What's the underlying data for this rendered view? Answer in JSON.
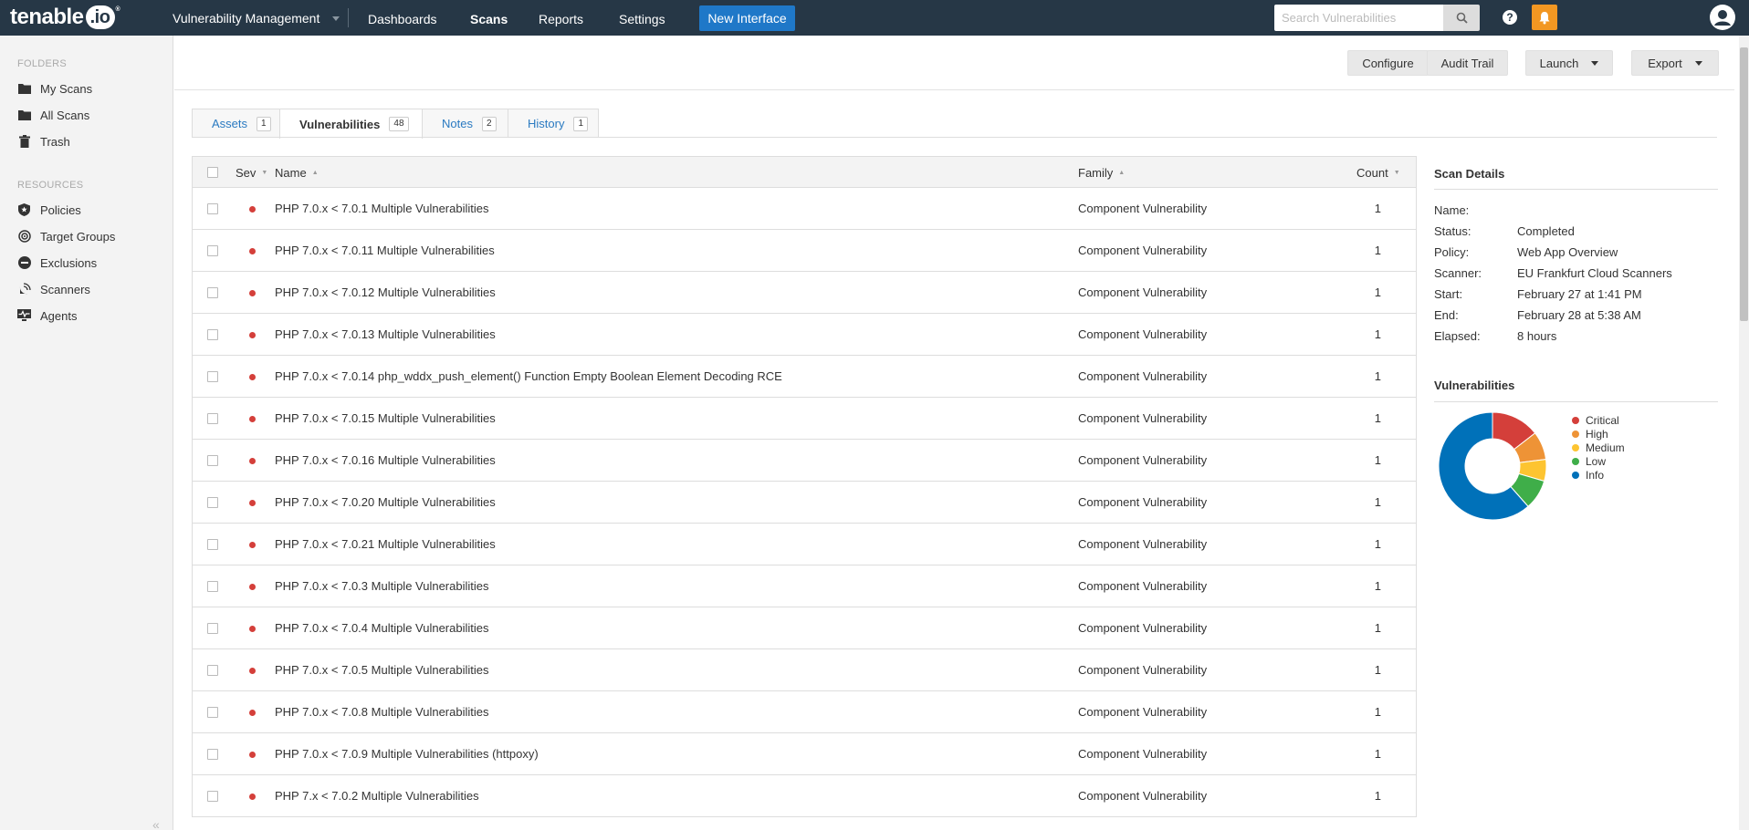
{
  "topbar": {
    "logo_text": "tenable",
    "logo_io": ".io",
    "logo_tm": "®",
    "app_menu": "Vulnerability Management",
    "nav": [
      "Dashboards",
      "Scans",
      "Reports",
      "Settings"
    ],
    "active_nav": "Scans",
    "new_interface": "New Interface",
    "search_placeholder": "Search Vulnerabilities"
  },
  "sidebar": {
    "folders_label": "FOLDERS",
    "folders": [
      "My Scans",
      "All Scans",
      "Trash"
    ],
    "resources_label": "RESOURCES",
    "resources": [
      "Policies",
      "Target Groups",
      "Exclusions",
      "Scanners",
      "Agents"
    ],
    "collapse": "«"
  },
  "toolbar": {
    "configure": "Configure",
    "audit_trail": "Audit Trail",
    "launch": "Launch",
    "export": "Export"
  },
  "tabs": [
    {
      "label": "Assets",
      "count": "1"
    },
    {
      "label": "Vulnerabilities",
      "count": "48"
    },
    {
      "label": "Notes",
      "count": "2"
    },
    {
      "label": "History",
      "count": "1"
    }
  ],
  "table": {
    "headers": {
      "sev": "Sev",
      "name": "Name",
      "family": "Family",
      "count": "Count"
    },
    "rows": [
      {
        "name": "PHP 7.0.x < 7.0.1 Multiple Vulnerabilities",
        "family": "Component Vulnerability",
        "count": "1"
      },
      {
        "name": "PHP 7.0.x < 7.0.11 Multiple Vulnerabilities",
        "family": "Component Vulnerability",
        "count": "1"
      },
      {
        "name": "PHP 7.0.x < 7.0.12 Multiple Vulnerabilities",
        "family": "Component Vulnerability",
        "count": "1"
      },
      {
        "name": "PHP 7.0.x < 7.0.13 Multiple Vulnerabilities",
        "family": "Component Vulnerability",
        "count": "1"
      },
      {
        "name": "PHP 7.0.x < 7.0.14 php_wddx_push_element() Function Empty Boolean Element Decoding RCE",
        "family": "Component Vulnerability",
        "count": "1"
      },
      {
        "name": "PHP 7.0.x < 7.0.15 Multiple Vulnerabilities",
        "family": "Component Vulnerability",
        "count": "1"
      },
      {
        "name": "PHP 7.0.x < 7.0.16 Multiple Vulnerabilities",
        "family": "Component Vulnerability",
        "count": "1"
      },
      {
        "name": "PHP 7.0.x < 7.0.20 Multiple Vulnerabilities",
        "family": "Component Vulnerability",
        "count": "1"
      },
      {
        "name": "PHP 7.0.x < 7.0.21 Multiple Vulnerabilities",
        "family": "Component Vulnerability",
        "count": "1"
      },
      {
        "name": "PHP 7.0.x < 7.0.3 Multiple Vulnerabilities",
        "family": "Component Vulnerability",
        "count": "1"
      },
      {
        "name": "PHP 7.0.x < 7.0.4 Multiple Vulnerabilities",
        "family": "Component Vulnerability",
        "count": "1"
      },
      {
        "name": "PHP 7.0.x < 7.0.5 Multiple Vulnerabilities",
        "family": "Component Vulnerability",
        "count": "1"
      },
      {
        "name": "PHP 7.0.x < 7.0.8 Multiple Vulnerabilities",
        "family": "Component Vulnerability",
        "count": "1"
      },
      {
        "name": "PHP 7.0.x < 7.0.9 Multiple Vulnerabilities (httpoxy)",
        "family": "Component Vulnerability",
        "count": "1"
      },
      {
        "name": "PHP 7.x < 7.0.2 Multiple Vulnerabilities",
        "family": "Component Vulnerability",
        "count": "1"
      }
    ],
    "severity_color": "#d43f3a"
  },
  "scan_details": {
    "title": "Scan Details",
    "items": [
      {
        "key": "Name:",
        "value": ""
      },
      {
        "key": "Status:",
        "value": "Completed"
      },
      {
        "key": "Policy:",
        "value": "Web App Overview"
      },
      {
        "key": "Scanner:",
        "value": "EU Frankfurt Cloud Scanners"
      },
      {
        "key": "Start:",
        "value": "February 27 at  1:41 PM"
      },
      {
        "key": "End:",
        "value": "February 28 at  5:38 AM"
      },
      {
        "key": "Elapsed:",
        "value": "8 hours"
      }
    ]
  },
  "vuln_chart": {
    "title": "Vulnerabilities",
    "legend": [
      {
        "label": "Critical",
        "color": "#d43f3a",
        "share": 0.145
      },
      {
        "label": "High",
        "color": "#ee9336",
        "share": 0.085
      },
      {
        "label": "Medium",
        "color": "#fdc431",
        "share": 0.065
      },
      {
        "label": "Low",
        "color": "#3fae49",
        "share": 0.09
      },
      {
        "label": "Info",
        "color": "#0071b9",
        "share": 0.615
      }
    ]
  }
}
